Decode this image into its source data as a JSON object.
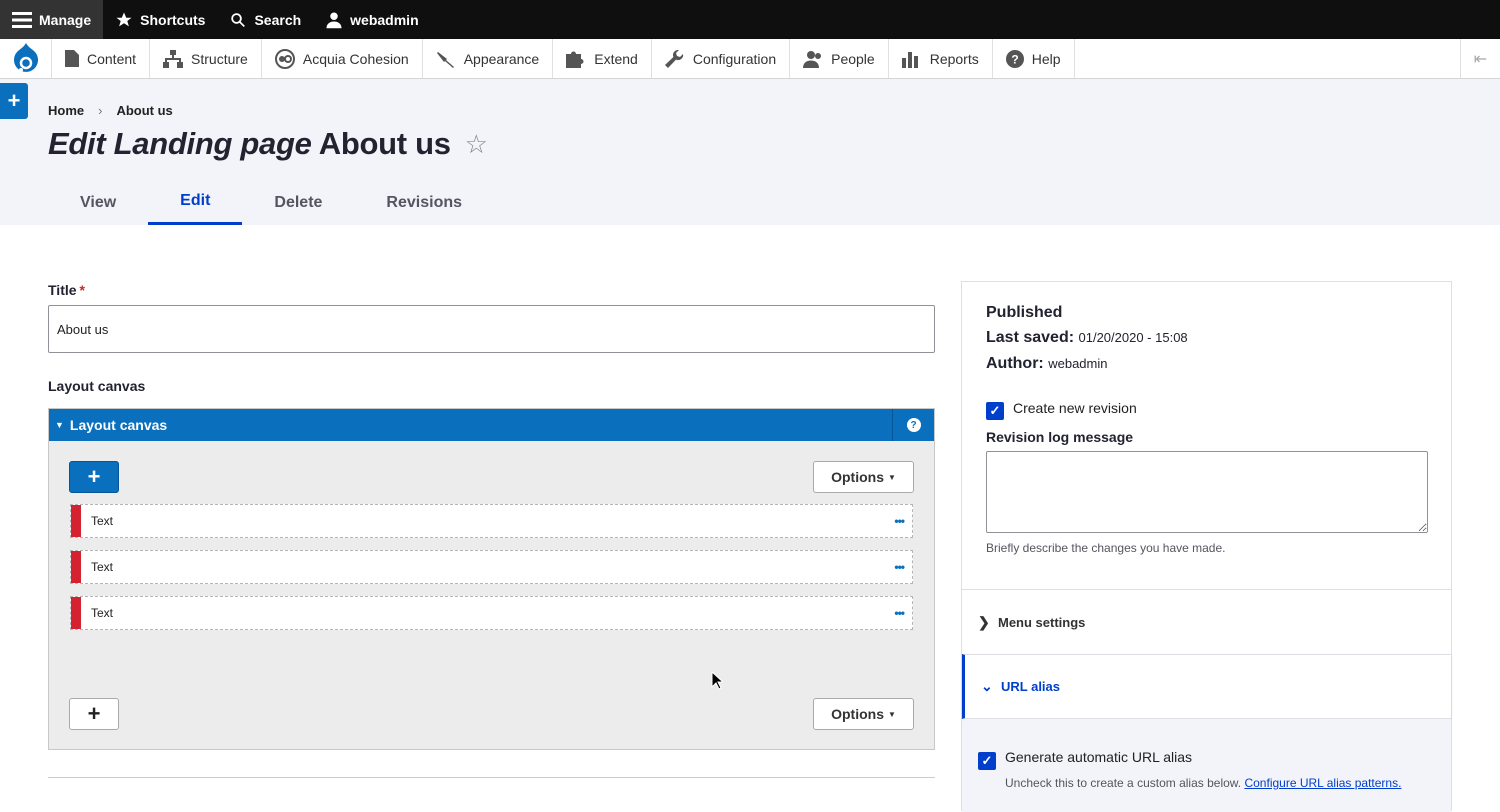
{
  "toolbar": {
    "manage": "Manage",
    "shortcuts": "Shortcuts",
    "search": "Search",
    "user": "webadmin"
  },
  "admin_menu": {
    "items": [
      {
        "label": "Content",
        "icon": "document-icon"
      },
      {
        "label": "Structure",
        "icon": "sitemap-icon"
      },
      {
        "label": "Acquia Cohesion",
        "icon": "cohesion-icon"
      },
      {
        "label": "Appearance",
        "icon": "paint-icon"
      },
      {
        "label": "Extend",
        "icon": "puzzle-icon"
      },
      {
        "label": "Configuration",
        "icon": "wrench-icon"
      },
      {
        "label": "People",
        "icon": "people-icon"
      },
      {
        "label": "Reports",
        "icon": "bar-chart-icon"
      },
      {
        "label": "Help",
        "icon": "help-icon"
      }
    ]
  },
  "breadcrumb": {
    "home": "Home",
    "sep": "›",
    "current": "About us"
  },
  "page": {
    "title_prefix": "Edit Landing page",
    "title_name": "About us"
  },
  "tabs": [
    {
      "label": "View"
    },
    {
      "label": "Edit",
      "active": true
    },
    {
      "label": "Delete"
    },
    {
      "label": "Revisions"
    }
  ],
  "form": {
    "title_label": "Title",
    "required_mark": "*",
    "title_value": "About us",
    "layout_label": "Layout canvas",
    "canvas_header": "Layout canvas",
    "options_label": "Options",
    "components": [
      {
        "label": "Text"
      },
      {
        "label": "Text"
      },
      {
        "label": "Text"
      }
    ]
  },
  "sidebar": {
    "status": "Published",
    "last_saved_label": "Last saved:",
    "last_saved_value": "01/20/2020 - 15:08",
    "author_label": "Author:",
    "author_value": "webadmin",
    "create_revision_label": "Create new revision",
    "revision_log_label": "Revision log message",
    "revision_log_hint": "Briefly describe the changes you have made.",
    "menu_settings": "Menu settings",
    "url_alias": "URL alias",
    "auto_alias_label": "Generate automatic URL alias",
    "auto_alias_hint": "Uncheck this to create a custom alias below.",
    "auto_alias_link": "Configure URL alias patterns."
  },
  "colors": {
    "accent": "#003ecc",
    "canvas_blue": "#0a6fbd",
    "component_red": "#d42231"
  }
}
